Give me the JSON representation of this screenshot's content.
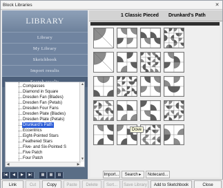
{
  "window": {
    "title": "Block Libraries",
    "close_glyph": "✕"
  },
  "sidebar": {
    "title": "Library",
    "nav": [
      {
        "label": "Library"
      },
      {
        "label": "My Library"
      },
      {
        "label": "Sketchbook"
      },
      {
        "label": "Import results"
      },
      {
        "label": "Search results"
      }
    ],
    "tree": [
      "Compasses",
      "Diamond in Square",
      "Dresden Fan (Blades)",
      "Dresden Fan (Petals)",
      "Dresden Four Fans",
      "Dresden Plate (Blades)",
      "Dresden Plate (Petals)",
      "Drunkard's Path",
      "Eccentrics",
      "Eight-Pointed Stars",
      "Feathered Stars",
      "Five- and Six-Pointed S",
      "Five Patch",
      "Four Patch"
    ],
    "selected_tree_item": "Drunkard's Path",
    "navigation_icons": [
      "first-icon",
      "prev-icon",
      "next-icon",
      "last-icon",
      "grid-large-icon",
      "grid-medium-icon",
      "grid-small-icon"
    ]
  },
  "header": {
    "left": "1 Classic Pieced",
    "right": "Drunkard's Path"
  },
  "tooltip": "Dove",
  "buttons": {
    "link_library": "Link Library",
    "cut": "Cut",
    "copy": "Copy",
    "paste": "Paste",
    "delete": "Delete",
    "sort": "Sort...",
    "import": "Import...",
    "search": "Search",
    "notecard": "Notecard...",
    "save_library": "Save Library",
    "add_to_sketchbook": "Add to Sketchbook",
    "close": "Close"
  },
  "colors": {
    "nav_bg": "#7084a0",
    "selected": "#2a5bd7",
    "block_fill": "#8c8c8c"
  }
}
